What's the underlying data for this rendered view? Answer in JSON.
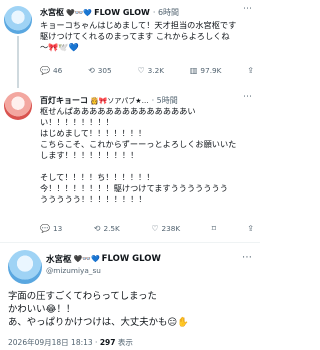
{
  "tweet1": {
    "name": "水宮枢",
    "name_emoji": "🖤👓💙",
    "brand": "FLOW GLOW",
    "time": "· 6時間",
    "text": "キョーコちゃんはじめまして！天才担当の水宮枢です\n駆けつけてくれるのまってます これからよろしくね\n〜🎀🕊️💙",
    "stats": {
      "replies": "46",
      "retweets": "305",
      "likes": "3.2K",
      "views": "97.9K"
    }
  },
  "tweet2": {
    "name": "百灯キョーコ",
    "name_emoji": "👸🎀ソアパブ★…",
    "time": "· 5時間",
    "text": "枢せんぱああああああああああああああい\nい！！！！！！！！\nはじめまして！！！！！！！\nこちらこそ、これからずーーっとよろしくお願いいた\nします！！！！！！！！！\n\nそして！！！！ち！！！！！！\n今！！！！！！！！駆けつけてますううううううう\nううううう！！！！！！！！",
    "stats": {
      "replies": "13",
      "retweets": "2.5K",
      "likes": "238K",
      "views": ""
    }
  },
  "main": {
    "name": "水宮枢",
    "name_emoji": "🖤👓💙",
    "brand": "FLOW GLOW",
    "handle": "@mizumiya_su",
    "text": "字面の圧すごくてわらってしまった\nかわいい😂！！\nあ、やっぱりかけつけは、大丈夫かも😑✋",
    "date": "2026年09月18日 18:13 · ",
    "views_count": "297",
    "views_label": " 表示"
  },
  "icons": {
    "reply": "reply-icon",
    "retweet": "retweet-icon",
    "like": "heart-icon",
    "views": "chart-icon",
    "bookmark": "bookmark-icon",
    "share": "share-icon",
    "more": "more-icon",
    "verified": "verified-badge-icon"
  }
}
